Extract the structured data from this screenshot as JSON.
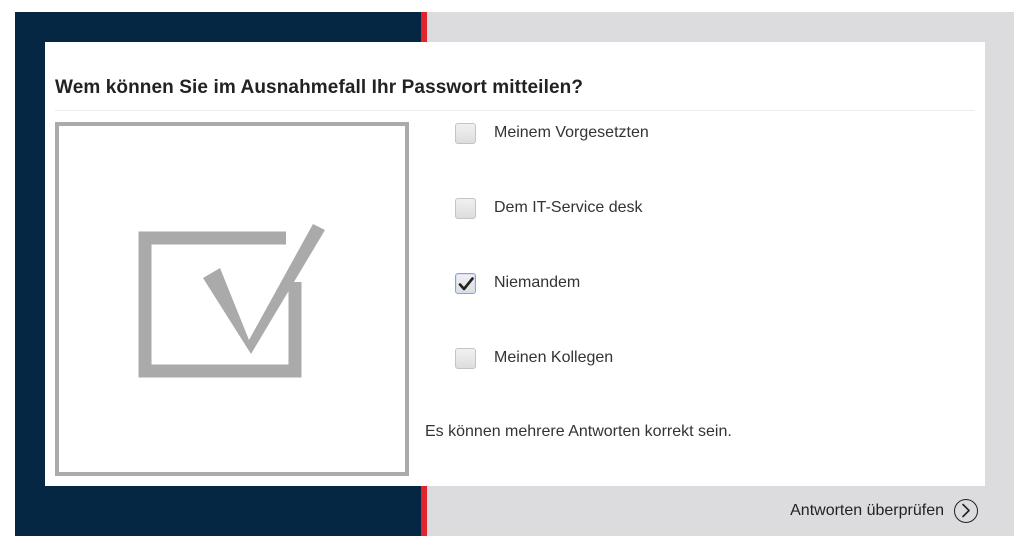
{
  "question": "Wem können Sie im Ausnahmefall Ihr Passwort mitteilen?",
  "illustration_icon": "checkbox-checkmark-icon",
  "options": [
    {
      "label": "Meinem Vorgesetzten",
      "checked": false
    },
    {
      "label": "Dem IT-Service desk",
      "checked": false
    },
    {
      "label": "Niemandem",
      "checked": true
    },
    {
      "label": "Meinen Kollegen",
      "checked": false
    }
  ],
  "hint": "Es können mehrere Antworten korrekt sein.",
  "submit_label": "Antworten überprüfen",
  "submit_icon": "chevron-right-circle-icon",
  "colors": {
    "navy_panel": "#052744",
    "accent_red": "#e2242c",
    "background_gray": "#dcdcde",
    "illustration_gray": "#aaaaaa"
  }
}
